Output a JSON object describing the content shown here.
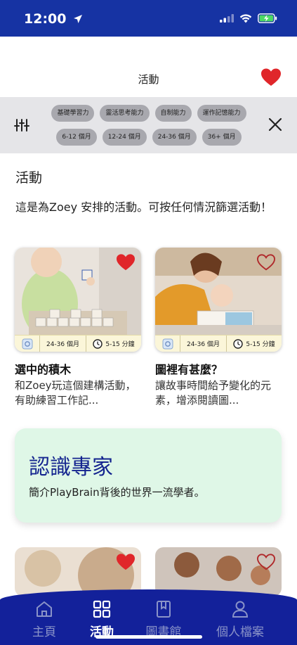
{
  "status_bar": {
    "time": "12:00"
  },
  "header": {
    "title": "活動"
  },
  "filters": {
    "row1": [
      "基礎學習力",
      "靈活思考能力",
      "自制能力",
      "運作記憶能力"
    ],
    "row2": [
      "6-12 個月",
      "12-24 個月",
      "24-36 個月",
      "36+ 個月"
    ]
  },
  "section": {
    "title": "活動",
    "description": "這是為Zoey 安排的活動。可按任何情況篩選活動！"
  },
  "cards": [
    {
      "age": "24-36 個月",
      "duration": "5-15 分鐘",
      "title": "選中的積木",
      "description": "和Zoey玩這個建構活動，有助練習工作記...",
      "favorited": true
    },
    {
      "age": "24-36 個月",
      "duration": "5-15 分鐘",
      "title": "圖裡有甚麼？",
      "description": "讓故事時間給予變化的元素，增添閱讀圖...",
      "favorited": false
    }
  ],
  "expert": {
    "title": "認識專家",
    "description": "簡介PlayBrain背後的世界一流學者。"
  },
  "tabs": [
    {
      "label": "主頁",
      "icon": "home-icon",
      "active": false
    },
    {
      "label": "活動",
      "icon": "grid-icon",
      "active": true
    },
    {
      "label": "圖書館",
      "icon": "book-icon",
      "active": false
    },
    {
      "label": "個人檔案",
      "icon": "person-icon",
      "active": false
    }
  ],
  "colors": {
    "brand_blue": "#1633a3",
    "tab_bar": "#13219a",
    "heart_red": "#e0262a",
    "expert_bg": "#dff7e7",
    "meta_bg": "#fbf6d9"
  }
}
